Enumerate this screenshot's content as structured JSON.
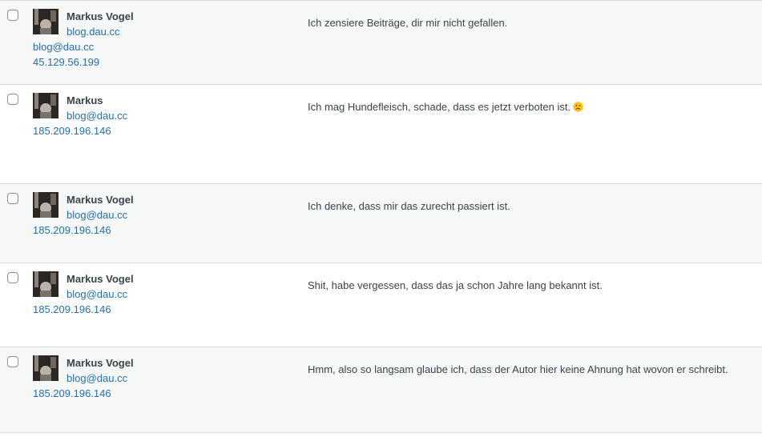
{
  "comments": [
    {
      "author": "Markus Vogel",
      "website": "blog.dau.cc",
      "email": "blog@dau.cc",
      "ip": "45.129.56.199",
      "text": "Ich zensiere Beiträge, dir mir nicht gefallen."
    },
    {
      "author": "Markus",
      "email": "blog@dau.cc",
      "ip": "185.209.196.146",
      "text": "Ich mag Hundefleisch, schade, dass es jetzt verboten ist.",
      "emoji": "frowning-face-icon"
    },
    {
      "author": "Markus Vogel",
      "email": "blog@dau.cc",
      "ip": "185.209.196.146",
      "text": "Ich denke, dass mir das zurecht passiert ist."
    },
    {
      "author": "Markus Vogel",
      "email": "blog@dau.cc",
      "ip": "185.209.196.146",
      "text": "Shit, habe vergessen, dass das ja schon Jahre lang bekannt ist."
    },
    {
      "author": "Markus Vogel",
      "email": "blog@dau.cc",
      "ip": "185.209.196.146",
      "text": "Hmm, also so langsam glaube ich, dass der Autor hier keine Ahnung hat wovon er schreibt."
    }
  ],
  "colors": {
    "link": "#2271b1",
    "text": "#3c434a",
    "alt_row": "#f6f7f7",
    "border": "#dcdcde"
  }
}
